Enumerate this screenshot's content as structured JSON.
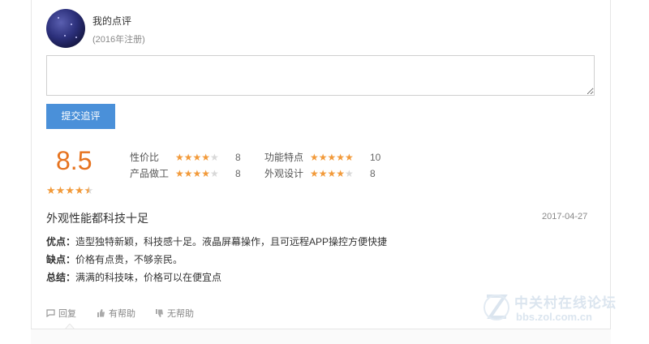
{
  "user": {
    "name": "我的点评",
    "registered": "(2016年注册)"
  },
  "reply": {
    "placeholder": "",
    "submit_label": "提交追评"
  },
  "scores": {
    "overall": "8.5",
    "overall_stars": 4.5,
    "items": [
      {
        "label": "性价比",
        "stars": 4,
        "value": "8"
      },
      {
        "label": "产品做工",
        "stars": 4,
        "value": "8"
      },
      {
        "label": "功能特点",
        "stars": 5,
        "value": "10"
      },
      {
        "label": "外观设计",
        "stars": 4,
        "value": "8"
      }
    ]
  },
  "review": {
    "title": "外观性能都科技十足",
    "date": "2017-04-27",
    "pros_label": "优点：",
    "pros": "造型独特新颖，科技感十足。液晶屏幕操作，且可远程APP操控方便快捷",
    "cons_label": "缺点：",
    "cons": "价格有点贵，不够亲民。",
    "summary_label": "总结：",
    "summary": "满满的科技味，价格可以在便宜点"
  },
  "actions": {
    "reply": "回复",
    "helpful": "有帮助",
    "unhelpful": "无帮助"
  },
  "watermark": {
    "name": "中关村在线论坛",
    "url": "bbs.zol.com.cn"
  },
  "colors": {
    "accent": "#4a90d9",
    "score": "#e6731f",
    "star": "#f29a3a"
  }
}
